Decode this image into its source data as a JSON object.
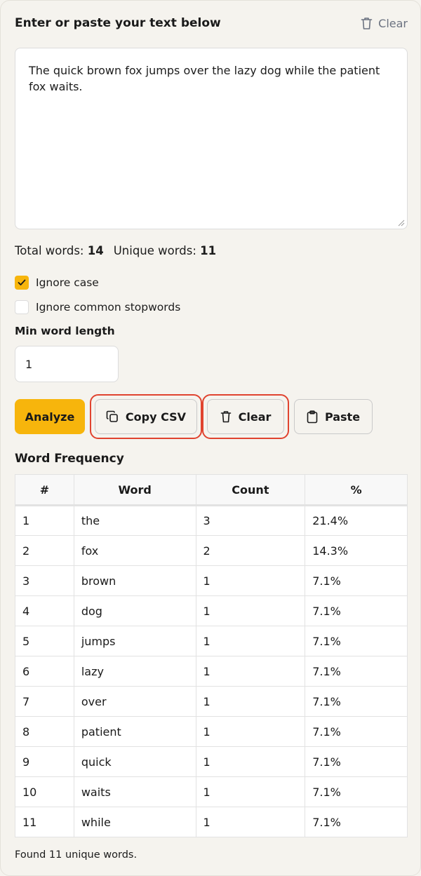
{
  "header": {
    "title": "Enter or paste your text below",
    "clear_label": "Clear"
  },
  "input": {
    "text": "The quick brown fox jumps over the lazy dog while the patient fox waits."
  },
  "stats": {
    "total_label": "Total words:",
    "total_value": "14",
    "unique_label": "Unique words:",
    "unique_value": "11"
  },
  "options": {
    "ignore_case": {
      "label": "Ignore case",
      "checked": true
    },
    "ignore_stopwords": {
      "label": "Ignore common stopwords",
      "checked": false
    },
    "min_length_label": "Min word length",
    "min_length_value": "1"
  },
  "actions": {
    "analyze": "Analyze",
    "copy_csv": "Copy CSV",
    "clear": "Clear",
    "paste": "Paste"
  },
  "results": {
    "title": "Word Frequency",
    "columns": [
      "#",
      "Word",
      "Count",
      "%"
    ],
    "rows": [
      [
        "1",
        "the",
        "3",
        "21.4%"
      ],
      [
        "2",
        "fox",
        "2",
        "14.3%"
      ],
      [
        "3",
        "brown",
        "1",
        "7.1%"
      ],
      [
        "4",
        "dog",
        "1",
        "7.1%"
      ],
      [
        "5",
        "jumps",
        "1",
        "7.1%"
      ],
      [
        "6",
        "lazy",
        "1",
        "7.1%"
      ],
      [
        "7",
        "over",
        "1",
        "7.1%"
      ],
      [
        "8",
        "patient",
        "1",
        "7.1%"
      ],
      [
        "9",
        "quick",
        "1",
        "7.1%"
      ],
      [
        "10",
        "waits",
        "1",
        "7.1%"
      ],
      [
        "11",
        "while",
        "1",
        "7.1%"
      ]
    ],
    "footer": "Found 11 unique words."
  },
  "colors": {
    "accent": "#f7b50c",
    "highlight": "#e0432f",
    "background": "#f5f3ee"
  },
  "icons": {
    "clear": "trash-icon",
    "copy": "copy-icon",
    "paste": "clipboard-icon",
    "check": "check-icon"
  }
}
